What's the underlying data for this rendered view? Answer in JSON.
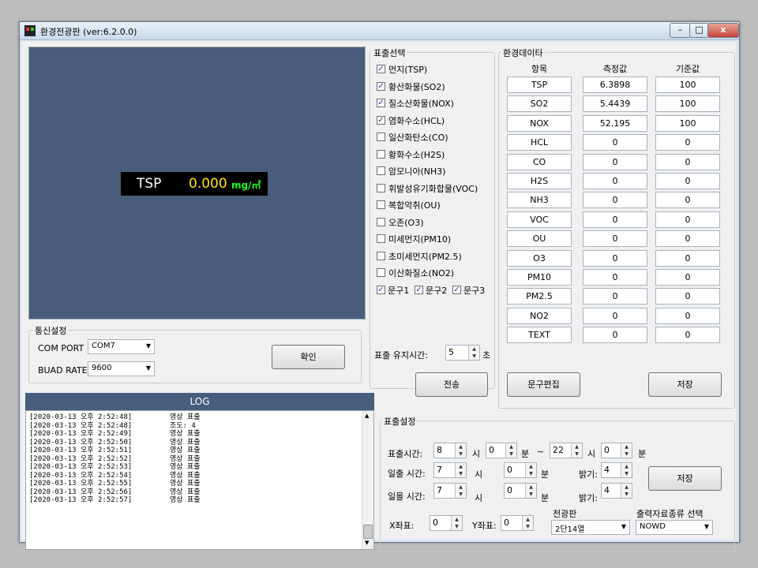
{
  "window": {
    "title": "환경전광판 (ver:6.2.0.0)",
    "minimize_label": "–",
    "maximize_label": "□",
    "close_label": "x"
  },
  "display": {
    "item": "TSP",
    "value": "0.000",
    "unit": "mg/㎥"
  },
  "comm": {
    "group_label": "통신설정",
    "com_port_label": "COM PORT",
    "com_port_value": "COM7",
    "baud_rate_label": "BUAD RATE",
    "baud_rate_value": "9600",
    "confirm_button": "확인"
  },
  "display_select": {
    "group_label": "표출선택",
    "items": [
      {
        "label": "먼지(TSP)",
        "checked": true
      },
      {
        "label": "황산화물(SO2)",
        "checked": true
      },
      {
        "label": "질소산화물(NOX)",
        "checked": true
      },
      {
        "label": "염화수소(HCL)",
        "checked": true
      },
      {
        "label": "일산화탄소(CO)",
        "checked": false
      },
      {
        "label": "황화수소(H2S)",
        "checked": false
      },
      {
        "label": "암모니아(NH3)",
        "checked": false
      },
      {
        "label": "휘발성유기화합물(VOC)",
        "checked": false
      },
      {
        "label": "복합악취(OU)",
        "checked": false
      },
      {
        "label": "오존(O3)",
        "checked": false
      },
      {
        "label": "미세먼지(PM10)",
        "checked": false
      },
      {
        "label": "초미세먼지(PM2.5)",
        "checked": false
      },
      {
        "label": "이산화질소(NO2)",
        "checked": false
      }
    ],
    "phrases": [
      {
        "label": "문구1",
        "checked": true
      },
      {
        "label": "문구2",
        "checked": true
      },
      {
        "label": "문구3",
        "checked": true
      }
    ],
    "hold_time_label": "표출 유지시간:",
    "hold_time_value": "5",
    "hold_time_unit": "초",
    "send_button": "전송"
  },
  "env_data": {
    "group_label": "환경데이타",
    "columns": [
      "항목",
      "측정값",
      "기준값"
    ],
    "rows": [
      {
        "item": "TSP",
        "measured": "6.3898",
        "standard": "100"
      },
      {
        "item": "SO2",
        "measured": "5.4439",
        "standard": "100"
      },
      {
        "item": "NOX",
        "measured": "52.195",
        "standard": "100"
      },
      {
        "item": "HCL",
        "measured": "0",
        "standard": "0"
      },
      {
        "item": "CO",
        "measured": "0",
        "standard": "0"
      },
      {
        "item": "H2S",
        "measured": "0",
        "standard": "0"
      },
      {
        "item": "NH3",
        "measured": "0",
        "standard": "0"
      },
      {
        "item": "VOC",
        "measured": "0",
        "standard": "0"
      },
      {
        "item": "OU",
        "measured": "0",
        "standard": "0"
      },
      {
        "item": "O3",
        "measured": "0",
        "standard": "0"
      },
      {
        "item": "PM10",
        "measured": "0",
        "standard": "0"
      },
      {
        "item": "PM2.5",
        "measured": "0",
        "standard": "0"
      },
      {
        "item": "NO2",
        "measured": "0",
        "standard": "0"
      },
      {
        "item": "TEXT",
        "measured": "0",
        "standard": "0"
      }
    ],
    "edit_phrase_button": "문구편집",
    "save_button": "저장"
  },
  "log": {
    "header": "LOG",
    "lines": [
      {
        "time": "[2020-03-13 오후 2:52:48]",
        "msg": "영상 표출"
      },
      {
        "time": "[2020-03-13 오후 2:52:48]",
        "msg": "조도: 4"
      },
      {
        "time": "[2020-03-13 오후 2:52:49]",
        "msg": "영상 표출"
      },
      {
        "time": "[2020-03-13 오후 2:52:50]",
        "msg": "영상 표출"
      },
      {
        "time": "[2020-03-13 오후 2:52:51]",
        "msg": "영상 표출"
      },
      {
        "time": "[2020-03-13 오후 2:52:52]",
        "msg": "영상 표출"
      },
      {
        "time": "[2020-03-13 오후 2:52:53]",
        "msg": "영상 표출"
      },
      {
        "time": "[2020-03-13 오후 2:52:54]",
        "msg": "영상 표출"
      },
      {
        "time": "[2020-03-13 오후 2:52:55]",
        "msg": "영상 표출"
      },
      {
        "time": "[2020-03-13 오후 2:52:56]",
        "msg": "영상 표출"
      },
      {
        "time": "[2020-03-13 오후 2:52:57]",
        "msg": "영상 표출"
      }
    ]
  },
  "display_settings": {
    "group_label": "표출설정",
    "display_time_label": "표출시간:",
    "start_hour": "8",
    "hour_unit": "시",
    "start_min": "0",
    "min_unit": "분",
    "range_sep": "~",
    "end_hour": "22",
    "end_min": "0",
    "sunrise_label": "일출 시간:",
    "sunrise_hour": "7",
    "sunrise_min": "0",
    "sunrise_brightness_label": "밝기:",
    "sunrise_brightness": "4",
    "sunset_label": "일몰 시간:",
    "sunset_hour": "7",
    "sunset_min": "0",
    "sunset_brightness_label": "밝기:",
    "sunset_brightness": "4",
    "save_button": "저장",
    "x_label": "X좌표:",
    "x_value": "0",
    "y_label": "Y좌표:",
    "y_value": "0",
    "board_label": "전광판",
    "board_value": "2단14열",
    "output_label": "출력자료종류 선택",
    "output_value": "NOWD"
  }
}
